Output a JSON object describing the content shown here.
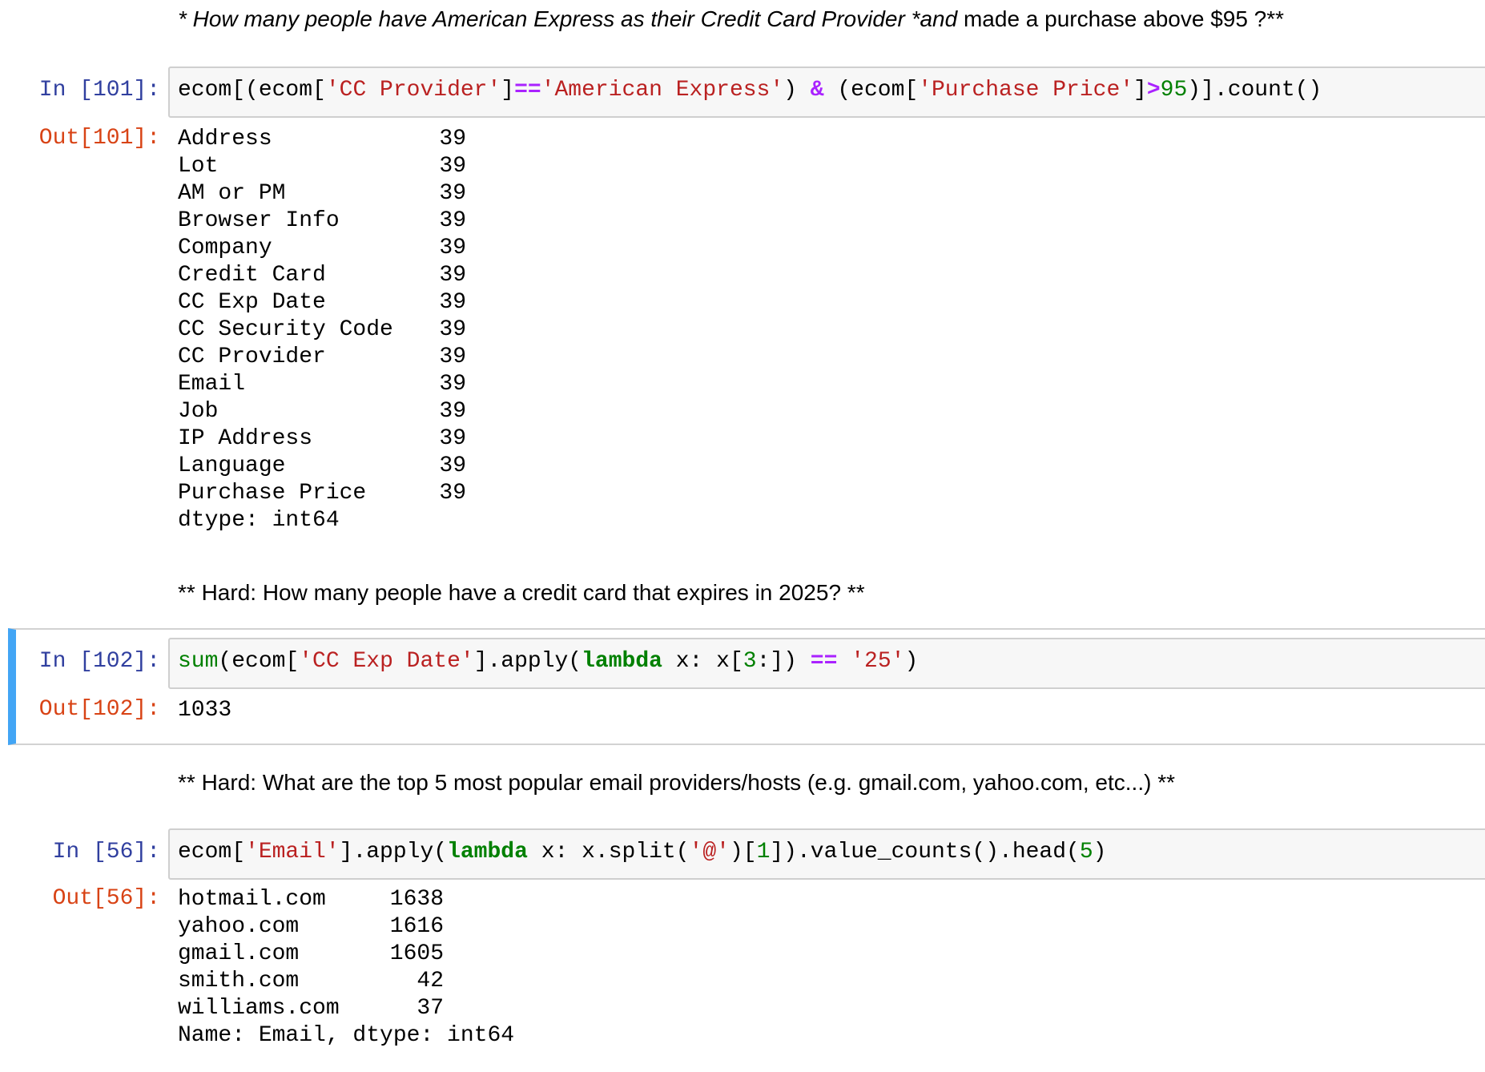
{
  "md1": {
    "part1": "* How many people have American Express as their Credit Card Provider *and",
    "part2": " made a purchase above $95 ?**"
  },
  "cell101": {
    "in_prompt": "In [101]:",
    "out_prompt": "Out[101]:",
    "code": {
      "a": "ecom[(ecom[",
      "s1": "'CC Provider'",
      "b": "]",
      "op1": "==",
      "s2": "'American Express'",
      "c": ") ",
      "op2": "&",
      "d": " (ecom[",
      "s3": "'Purchase Price'",
      "e": "]",
      "op3": ">",
      "n1": "95",
      "f": ")].count()"
    },
    "rows": [
      {
        "label": "Address",
        "value": "39"
      },
      {
        "label": "Lot",
        "value": "39"
      },
      {
        "label": "AM or PM",
        "value": "39"
      },
      {
        "label": "Browser Info",
        "value": "39"
      },
      {
        "label": "Company",
        "value": "39"
      },
      {
        "label": "Credit Card",
        "value": "39"
      },
      {
        "label": "CC Exp Date",
        "value": "39"
      },
      {
        "label": "CC Security Code",
        "value": "39"
      },
      {
        "label": "CC Provider",
        "value": "39"
      },
      {
        "label": "Email",
        "value": "39"
      },
      {
        "label": "Job",
        "value": "39"
      },
      {
        "label": "IP Address",
        "value": "39"
      },
      {
        "label": "Language",
        "value": "39"
      },
      {
        "label": "Purchase Price",
        "value": "39"
      }
    ],
    "dtype": "dtype: int64"
  },
  "md2": "** Hard: How many people have a credit card that expires in 2025? **",
  "cell102": {
    "in_prompt": "In [102]:",
    "out_prompt": "Out[102]:",
    "code": {
      "fn": "sum",
      "a": "(ecom[",
      "s1": "'CC Exp Date'",
      "b": "].apply(",
      "kw": "lambda",
      "c": " x: x[",
      "n1": "3",
      "d": ":]) ",
      "op1": "==",
      "e": " ",
      "s2": "'25'",
      "f": ")"
    },
    "result": "1033"
  },
  "md3": "** Hard: What are the top 5 most popular email providers/hosts (e.g. gmail.com, yahoo.com, etc...) **",
  "cell56": {
    "in_prompt": "In [56]:",
    "out_prompt": "Out[56]:",
    "code": {
      "a": "ecom[",
      "s1": "'Email'",
      "b": "].apply(",
      "kw": "lambda",
      "c": " x: x.split(",
      "s2": "'@'",
      "d": ")[",
      "n1": "1",
      "e": "]).value_counts().head(",
      "n2": "5",
      "f": ")"
    },
    "rows": [
      {
        "label": "hotmail.com",
        "value": "1638"
      },
      {
        "label": "yahoo.com",
        "value": "1616"
      },
      {
        "label": "gmail.com",
        "value": "1605"
      },
      {
        "label": "smith.com",
        "value": "42"
      },
      {
        "label": "williams.com",
        "value": "37"
      }
    ],
    "footer": "Name: Email, dtype: int64"
  }
}
